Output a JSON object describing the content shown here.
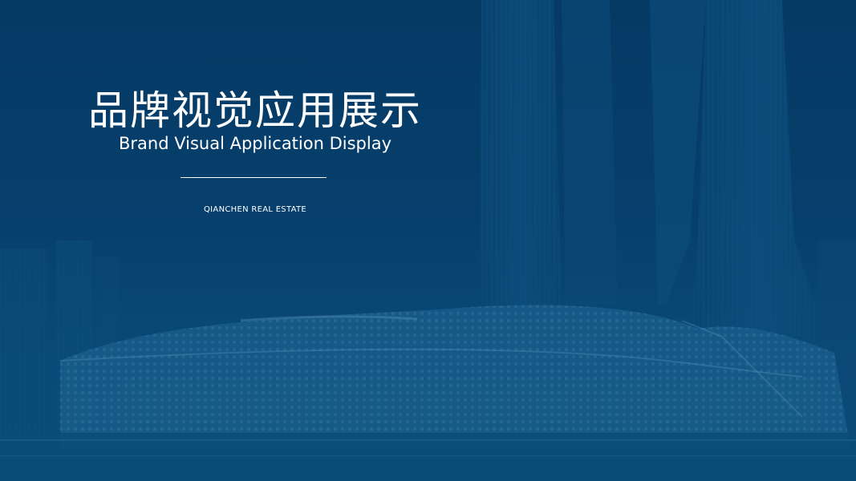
{
  "slide": {
    "title_cn": "品牌视觉应用展示",
    "title_en": "Brand Visual Application Display",
    "company": "QIANCHEN REAL ESTATE"
  },
  "colors": {
    "background": "#063d6a",
    "text": "#ffffff"
  }
}
